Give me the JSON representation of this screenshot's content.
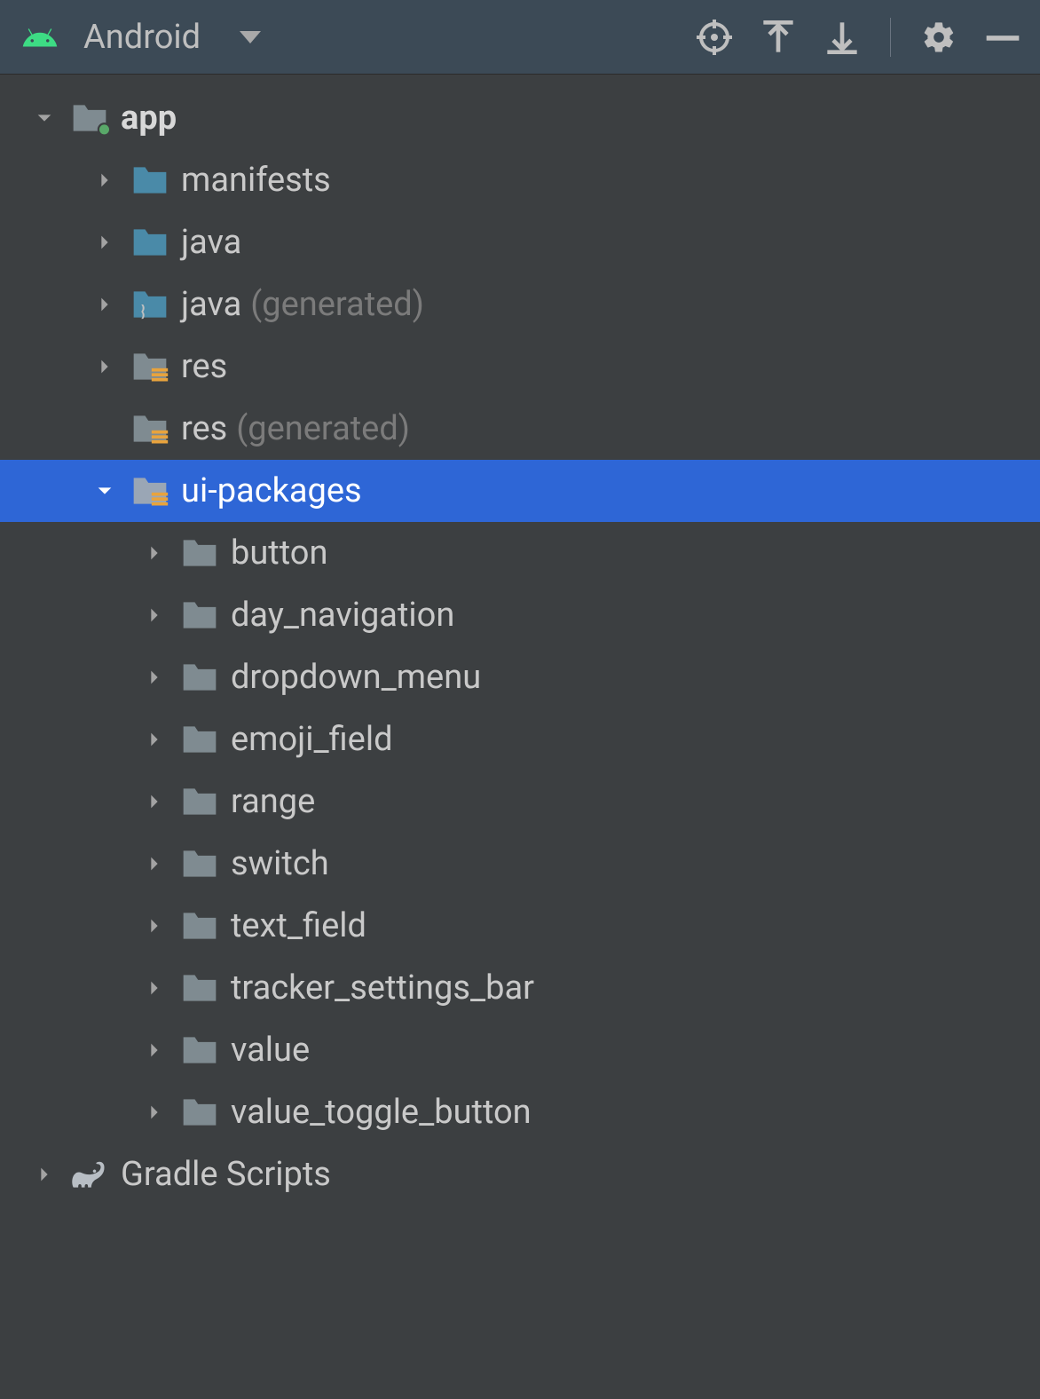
{
  "toolbar": {
    "view_label": "Android"
  },
  "tree": {
    "app": {
      "label": "app",
      "children": {
        "manifests": "manifests",
        "java": "java",
        "java_gen_label": "java",
        "java_gen_suffix": "(generated)",
        "res": "res",
        "res_gen_label": "res",
        "res_gen_suffix": "(generated)",
        "ui_packages": {
          "label": "ui-packages",
          "children": [
            "button",
            "day_navigation",
            "dropdown_menu",
            "emoji_field",
            "range",
            "switch",
            "text_field",
            "tracker_settings_bar",
            "value",
            "value_toggle_button"
          ]
        }
      }
    },
    "gradle_scripts": "Gradle Scripts"
  }
}
